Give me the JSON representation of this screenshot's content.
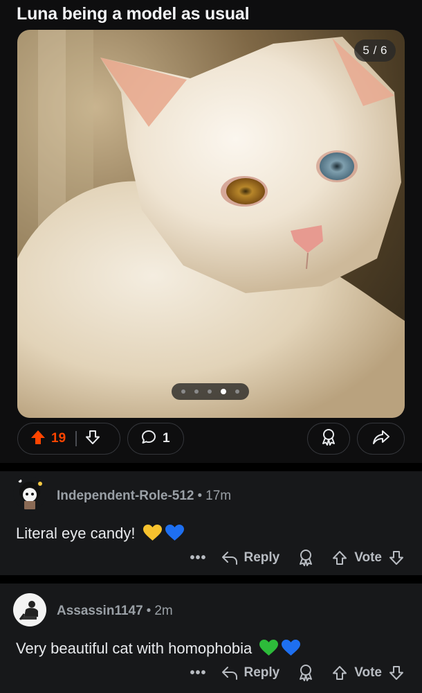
{
  "post": {
    "title": "Luna being a model as usual",
    "gallery": {
      "counter": "5 / 6",
      "total_images": 6,
      "current_index": 5
    },
    "upvotes": "19",
    "comments": "1"
  },
  "comments": [
    {
      "username": "Independent-Role-512",
      "separator": "•",
      "time": "17m",
      "body": "Literal eye candy!",
      "emojis": [
        "yellow-heart",
        "blue-heart"
      ],
      "more_label": "•••",
      "reply_label": "Reply",
      "vote_label": "Vote"
    },
    {
      "username": "Assassin1147",
      "separator": "•",
      "time": "2m",
      "body": "Very beautiful cat with homophobia",
      "emojis": [
        "green-heart",
        "blue-heart"
      ],
      "more_label": "•••",
      "reply_label": "Reply",
      "vote_label": "Vote"
    }
  ],
  "colors": {
    "upvote_active": "#ff4500",
    "background": "#0e0e0f",
    "comment_bg": "#17181a",
    "muted_text": "#9aa0a6"
  },
  "icons": [
    "upvote-icon",
    "downvote-icon",
    "comment-icon",
    "award-icon",
    "share-icon",
    "reply-icon",
    "more-icon"
  ]
}
